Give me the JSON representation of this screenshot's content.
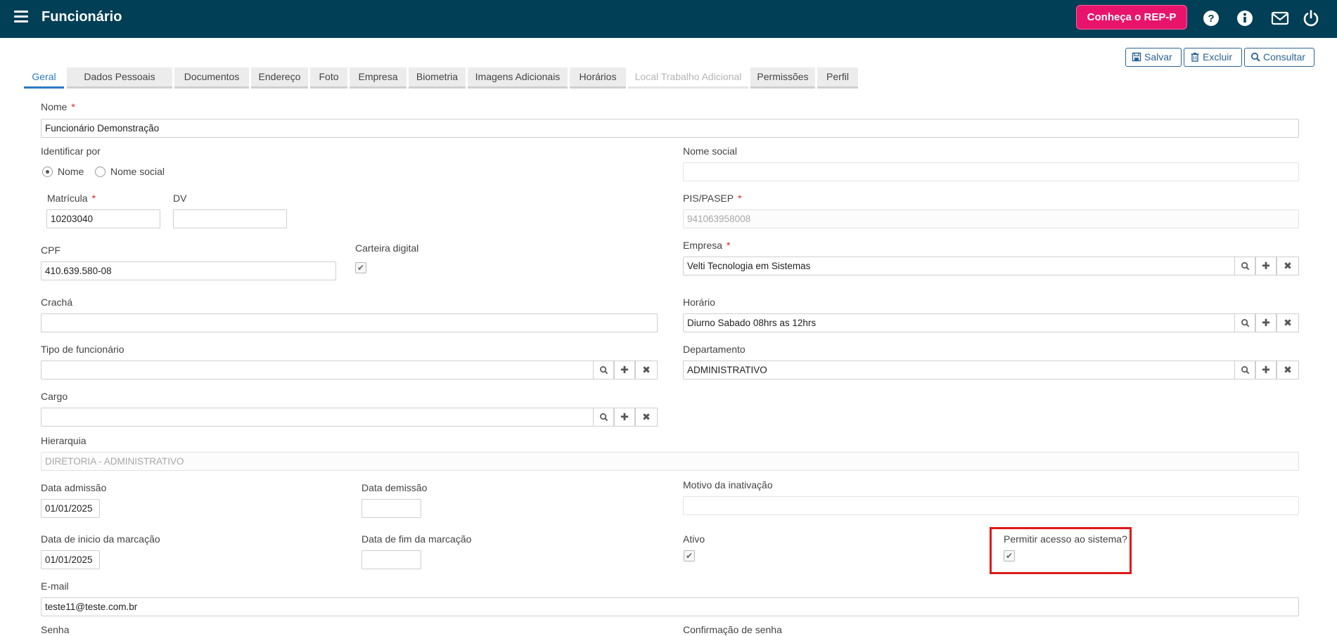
{
  "header": {
    "title": "Funcionário",
    "rep_button": "Conheça o REP-P",
    "icons": [
      "help-icon",
      "info-icon",
      "mail-icon",
      "power-icon"
    ]
  },
  "toolbar": {
    "save": "Salvar",
    "delete": "Excluir",
    "search": "Consultar"
  },
  "tabs": [
    {
      "label": "Geral",
      "state": "active"
    },
    {
      "label": "Dados Pessoais",
      "state": "normal"
    },
    {
      "label": "Documentos",
      "state": "normal"
    },
    {
      "label": "Endereço",
      "state": "normal"
    },
    {
      "label": "Foto",
      "state": "normal"
    },
    {
      "label": "Empresa",
      "state": "normal"
    },
    {
      "label": "Biometria",
      "state": "normal"
    },
    {
      "label": "Imagens Adicionais",
      "state": "normal"
    },
    {
      "label": "Horários",
      "state": "normal"
    },
    {
      "label": "Local Trabalho Adicional",
      "state": "disabled"
    },
    {
      "label": "Permissões",
      "state": "normal"
    },
    {
      "label": "Perfil",
      "state": "normal"
    }
  ],
  "form": {
    "nome": {
      "label": "Nome",
      "value": "Funcionário Demonstração"
    },
    "identificar": {
      "label": "Identificar por",
      "option_nome": "Nome",
      "option_social": "Nome social",
      "selected": "Nome"
    },
    "nome_social": {
      "label": "Nome social",
      "value": ""
    },
    "matricula": {
      "label": "Matrícula",
      "value": "10203040"
    },
    "dv": {
      "label": "DV",
      "value": ""
    },
    "pis": {
      "label": "PIS/PASEP",
      "value": "941063958008"
    },
    "cpf": {
      "label": "CPF",
      "value": "410.639.580-08"
    },
    "carteira": {
      "label": "Carteira digital",
      "checked": true
    },
    "empresa": {
      "label": "Empresa",
      "value": "Velti Tecnologia em Sistemas"
    },
    "cracha": {
      "label": "Crachá",
      "value": ""
    },
    "horario": {
      "label": "Horário",
      "value": "Diurno Sabado 08hrs as 12hrs"
    },
    "tipo": {
      "label": "Tipo de funcionário",
      "value": ""
    },
    "departamento": {
      "label": "Departamento",
      "value": "ADMINISTRATIVO"
    },
    "cargo": {
      "label": "Cargo",
      "value": ""
    },
    "hierarquia": {
      "label": "Hierarquia",
      "value": "DIRETORIA - ADMINISTRATIVO"
    },
    "admissao": {
      "label": "Data admissão",
      "value": "01/01/2025"
    },
    "demissao": {
      "label": "Data demissão",
      "value": ""
    },
    "motivo": {
      "label": "Motivo da inativação",
      "value": ""
    },
    "inicio_marcacao": {
      "label": "Data de inicio da marcação",
      "value": "01/01/2025"
    },
    "fim_marcacao": {
      "label": "Data de fim da marcação",
      "value": ""
    },
    "ativo": {
      "label": "Ativo",
      "checked": true
    },
    "acesso": {
      "label": "Permitir acesso ao sistema?",
      "checked": true
    },
    "email": {
      "label": "E-mail",
      "value": "teste11@teste.com.br"
    },
    "senha": {
      "label": "Senha"
    },
    "confirmacao": {
      "label": "Confirmação de senha"
    }
  },
  "required_marker": "*",
  "colors": {
    "header": "#003f56",
    "accent": "#e8146c",
    "tab_active": "#2a7bc4",
    "highlight": "#e01818"
  }
}
